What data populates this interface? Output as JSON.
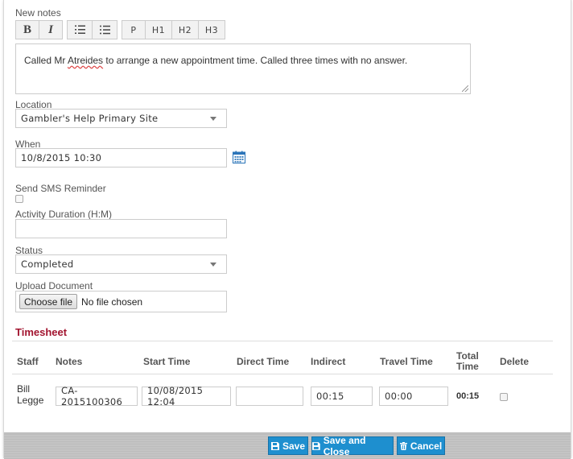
{
  "notes": {
    "label": "New notes",
    "text_before": "Called Mr ",
    "text_misspelled": "Atreides",
    "text_after": " to arrange a new appointment time. Called three times with no answer."
  },
  "toolbar": {
    "bold": "B",
    "italic": "I",
    "p": "P",
    "h1": "H1",
    "h2": "H2",
    "h3": "H3",
    "ordered_list_icon": "ordered-list-icon",
    "unordered_list_icon": "unordered-list-icon"
  },
  "location": {
    "label": "Location",
    "value": "Gambler's Help Primary Site"
  },
  "when": {
    "label": "When",
    "value": "10/8/2015 10:30",
    "icon": "calendar-icon"
  },
  "sms": {
    "label": "Send SMS Reminder",
    "checked": false
  },
  "duration": {
    "label": "Activity Duration (H:M)",
    "value": ""
  },
  "status": {
    "label": "Status",
    "value": "Completed"
  },
  "upload": {
    "label": "Upload Document",
    "button": "Choose file",
    "file_status": "No file chosen"
  },
  "timesheet": {
    "title": "Timesheet",
    "columns": {
      "staff": "Staff",
      "notes": "Notes",
      "start_time": "Start Time",
      "direct_time": "Direct Time",
      "indirect": "Indirect",
      "travel_time": "Travel Time",
      "total_time_1": "Total",
      "total_time_2": "Time",
      "delete": "Delete"
    },
    "rows": [
      {
        "staff_first": "Bill",
        "staff_last": "Legge",
        "notes": "CA-2015100306",
        "start_time": "10/08/2015 12:04",
        "direct_time": "",
        "indirect": "00:15",
        "travel_time": "00:00",
        "total_time": "00:15"
      }
    ]
  },
  "footer": {
    "save": "Save",
    "save_close": "Save and Close",
    "cancel": "Cancel",
    "accent": "#1e8fcf"
  }
}
